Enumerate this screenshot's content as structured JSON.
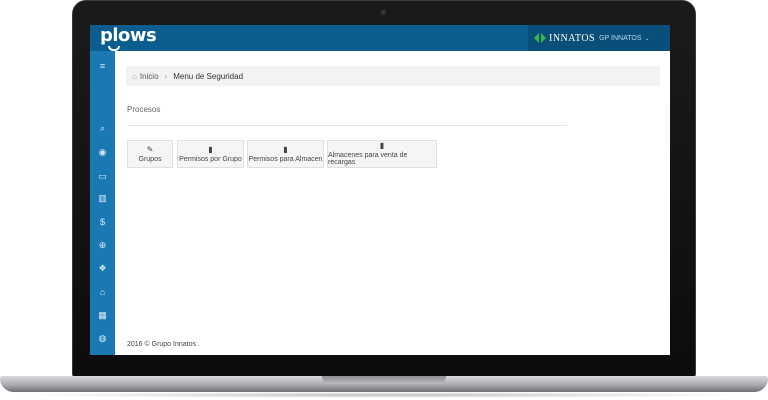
{
  "header": {
    "logo_text": "plows",
    "brand_name": "INNATOS",
    "user_label": "GP INNATOS",
    "caret": "⌄",
    "colors": {
      "topbar": "#0b5d8f",
      "brand_box": "#0a4f7a",
      "brand_accent": "#3cb54a"
    }
  },
  "sidebar": {
    "color": "#1a79b3",
    "items": [
      {
        "icon": "menu-icon",
        "glyph": "≡"
      },
      {
        "icon": "search-icon",
        "glyph": "⌕"
      },
      {
        "icon": "eye-icon",
        "glyph": "◉"
      },
      {
        "icon": "folder-icon",
        "glyph": "▭"
      },
      {
        "icon": "barcode-icon",
        "glyph": "▥"
      },
      {
        "icon": "dollar-icon",
        "glyph": "$"
      },
      {
        "icon": "lifesaver-icon",
        "glyph": "⊕"
      },
      {
        "icon": "cubes-icon",
        "glyph": "❖"
      },
      {
        "icon": "bank-icon",
        "glyph": "⌂"
      },
      {
        "icon": "calculator-icon",
        "glyph": "▦"
      },
      {
        "icon": "globe-icon",
        "glyph": "◍"
      },
      {
        "icon": "cart-icon",
        "glyph": "⛟"
      }
    ]
  },
  "breadcrumb": {
    "home_icon": "home-icon",
    "home": "Inicio",
    "separator": "›",
    "current": "Menu de Seguridad"
  },
  "section": {
    "title": "Procesos"
  },
  "processes": [
    {
      "label": "Grupos",
      "icon": "edit-icon",
      "glyph": "✎"
    },
    {
      "label": "Permisos por Grupo",
      "icon": "book-icon",
      "glyph": "▮"
    },
    {
      "label": "Permisos para Almacen",
      "icon": "book-icon",
      "glyph": "▮"
    },
    {
      "label": "Almacenes para venta de recargas",
      "icon": "book-icon",
      "glyph": "▮"
    }
  ],
  "footer": {
    "text": "2016 © Grupo Innatos ."
  }
}
